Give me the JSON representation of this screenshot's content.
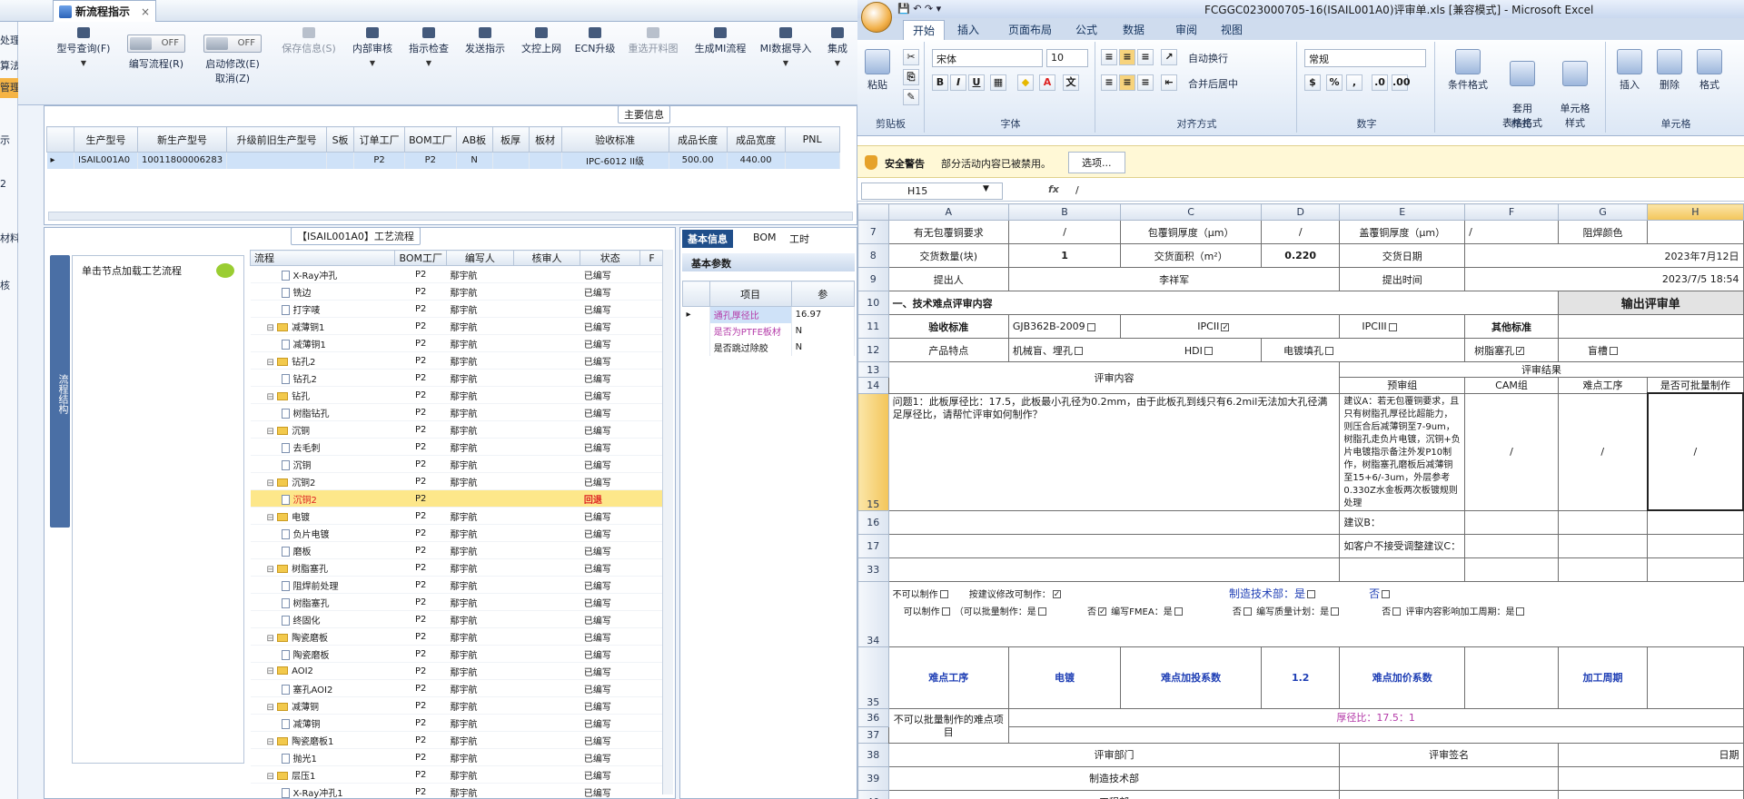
{
  "left_app": {
    "tab": {
      "label": "新流程指示",
      "close": "×"
    },
    "nav_items": [
      "处理",
      "算法",
      "管理",
      "示",
      "2",
      "材料",
      "核"
    ],
    "ribbon": [
      {
        "label": "型号查询(F)",
        "enabled": true
      },
      {
        "label": "编写流程(R)",
        "toggle": "OFF"
      },
      {
        "label": "启动修改(E)",
        "sub": "取消(Z)",
        "toggle": "OFF"
      },
      {
        "label": "保存信息(S)",
        "enabled": false
      },
      {
        "label": "内部审核",
        "enabled": true
      },
      {
        "label": "指示检查",
        "enabled": true
      },
      {
        "label": "发送指示",
        "enabled": true
      },
      {
        "label": "文控上网",
        "enabled": true
      },
      {
        "label": "ECN升级",
        "enabled": true
      },
      {
        "label": "重选开料图",
        "enabled": false
      },
      {
        "label": "生成MI流程",
        "enabled": true
      },
      {
        "label": "MI数据导入",
        "enabled": true
      },
      {
        "label": "集成",
        "enabled": true
      }
    ],
    "main_info": {
      "title": "主要信息",
      "headers": [
        "生产型号",
        "新生产型号",
        "升级前旧生产型号",
        "S板",
        "订单工厂",
        "BOM工厂",
        "AB板",
        "板厚",
        "板材",
        "验收标准",
        "成品长度",
        "成品宽度",
        "PNL"
      ],
      "row": [
        "ISAIL001A0",
        "10011800006283",
        "",
        "",
        "P2",
        "P2",
        "N",
        "",
        "",
        "IPC-6012 II级",
        "500.00",
        "440.00",
        ""
      ]
    },
    "flow": {
      "title": "【ISAIL001A0】工艺流程",
      "vtab": "流程结构",
      "hint": "单击节点加载工艺流程",
      "headers": [
        "流程",
        "BOM工厂",
        "编写人",
        "核审人",
        "状态",
        "F"
      ],
      "rows": [
        {
          "level": 1,
          "type": "doc",
          "name": "X-Ray冲孔",
          "bom": "P2",
          "writer": "鄢宇航",
          "status": "已编写"
        },
        {
          "level": 1,
          "type": "doc",
          "name": "铣边",
          "bom": "P2",
          "writer": "鄢宇航",
          "status": "已编写"
        },
        {
          "level": 1,
          "type": "doc",
          "name": "打字唛",
          "bom": "P2",
          "writer": "鄢宇航",
          "status": "已编写"
        },
        {
          "level": 0,
          "type": "folder",
          "name": "减薄铜1",
          "bom": "P2",
          "writer": "鄢宇航",
          "status": "已编写"
        },
        {
          "level": 1,
          "type": "doc",
          "name": "减薄铜1",
          "bom": "P2",
          "writer": "鄢宇航",
          "status": "已编写"
        },
        {
          "level": 0,
          "type": "folder",
          "name": "钻孔2",
          "bom": "P2",
          "writer": "鄢宇航",
          "status": "已编写"
        },
        {
          "level": 1,
          "type": "doc",
          "name": "钻孔2",
          "bom": "P2",
          "writer": "鄢宇航",
          "status": "已编写"
        },
        {
          "level": 0,
          "type": "folder",
          "name": "钻孔",
          "bom": "P2",
          "writer": "鄢宇航",
          "status": "已编写"
        },
        {
          "level": 1,
          "type": "doc",
          "name": "树脂钻孔",
          "bom": "P2",
          "writer": "鄢宇航",
          "status": "已编写"
        },
        {
          "level": 0,
          "type": "folder",
          "name": "沉铜",
          "bom": "P2",
          "writer": "鄢宇航",
          "status": "已编写"
        },
        {
          "level": 1,
          "type": "doc",
          "name": "去毛刺",
          "bom": "P2",
          "writer": "鄢宇航",
          "status": "已编写"
        },
        {
          "level": 1,
          "type": "doc",
          "name": "沉铜",
          "bom": "P2",
          "writer": "鄢宇航",
          "status": "已编写"
        },
        {
          "level": 0,
          "type": "folder",
          "name": "沉铜2",
          "bom": "P2",
          "writer": "鄢宇航",
          "status": "已编写"
        },
        {
          "level": 1,
          "type": "doc",
          "name": "沉铜2",
          "bom": "P2",
          "writer": "",
          "status": "回退",
          "highlight": true
        },
        {
          "level": 0,
          "type": "folder",
          "name": "电镀",
          "bom": "P2",
          "writer": "鄢宇航",
          "status": "已编写"
        },
        {
          "level": 1,
          "type": "doc",
          "name": "负片电镀",
          "bom": "P2",
          "writer": "鄢宇航",
          "status": "已编写"
        },
        {
          "level": 1,
          "type": "doc",
          "name": "磨板",
          "bom": "P2",
          "writer": "鄢宇航",
          "status": "已编写"
        },
        {
          "level": 0,
          "type": "folder",
          "name": "树脂塞孔",
          "bom": "P2",
          "writer": "鄢宇航",
          "status": "已编写"
        },
        {
          "level": 1,
          "type": "doc",
          "name": "阻焊前处理",
          "bom": "P2",
          "writer": "鄢宇航",
          "status": "已编写"
        },
        {
          "level": 1,
          "type": "doc",
          "name": "树脂塞孔",
          "bom": "P2",
          "writer": "鄢宇航",
          "status": "已编写"
        },
        {
          "level": 1,
          "type": "doc",
          "name": "终固化",
          "bom": "P2",
          "writer": "鄢宇航",
          "status": "已编写"
        },
        {
          "level": 0,
          "type": "folder",
          "name": "陶瓷磨板",
          "bom": "P2",
          "writer": "鄢宇航",
          "status": "已编写"
        },
        {
          "level": 1,
          "type": "doc",
          "name": "陶瓷磨板",
          "bom": "P2",
          "writer": "鄢宇航",
          "status": "已编写"
        },
        {
          "level": 0,
          "type": "folder",
          "name": "AOI2",
          "bom": "P2",
          "writer": "鄢宇航",
          "status": "已编写"
        },
        {
          "level": 1,
          "type": "doc",
          "name": "塞孔AOI2",
          "bom": "P2",
          "writer": "鄢宇航",
          "status": "已编写"
        },
        {
          "level": 0,
          "type": "folder",
          "name": "减薄铜",
          "bom": "P2",
          "writer": "鄢宇航",
          "status": "已编写"
        },
        {
          "level": 1,
          "type": "doc",
          "name": "减薄铜",
          "bom": "P2",
          "writer": "鄢宇航",
          "status": "已编写"
        },
        {
          "level": 0,
          "type": "folder",
          "name": "陶瓷磨板1",
          "bom": "P2",
          "writer": "鄢宇航",
          "status": "已编写"
        },
        {
          "level": 1,
          "type": "doc",
          "name": "抛光1",
          "bom": "P2",
          "writer": "鄢宇航",
          "status": "已编写"
        },
        {
          "level": 0,
          "type": "folder",
          "name": "层压1",
          "bom": "P2",
          "writer": "鄢宇航",
          "status": "已编写"
        },
        {
          "level": 1,
          "type": "doc",
          "name": "X-Ray冲孔1",
          "bom": "P2",
          "writer": "鄢宇航",
          "status": "已编写"
        }
      ]
    },
    "params": {
      "tabs": [
        "基本信息",
        "BOM",
        "工时"
      ],
      "subtab": "基本参数",
      "col_header": "项目",
      "col_value": "参",
      "rows": [
        {
          "item": "通孔厚径比",
          "value": "16.97",
          "selected": true
        },
        {
          "item": "是否为PTFE板材",
          "value": "N"
        },
        {
          "item": "是否跳过除胶",
          "value": "N"
        }
      ]
    }
  },
  "excel": {
    "title": "FCGGC023000705-16(ISAIL001A0)评审单.xls  [兼容模式] - Microsoft Excel",
    "tabs": [
      "开始",
      "插入",
      "页面布局",
      "公式",
      "数据",
      "审阅",
      "视图"
    ],
    "ribbon": {
      "clipboard": {
        "label": "剪贴板",
        "paste": "粘贴"
      },
      "font": {
        "label": "字体",
        "name": "宋体",
        "size": "10"
      },
      "align": {
        "label": "对齐方式",
        "wrap": "自动换行",
        "merge": "合并后居中"
      },
      "number": {
        "label": "数字",
        "format": "常规"
      },
      "styles": {
        "label": "样式",
        "cond": "条件格式",
        "table": "套用\n表格格式",
        "cell": "单元格\n样式"
      },
      "cells": {
        "label": "单元格",
        "insert": "插入",
        "delete": "删除",
        "format": "格式"
      }
    },
    "security": {
      "label": "安全警告",
      "msg": "部分活动内容已被禁用。",
      "btn": "选项..."
    },
    "namebox": "H15",
    "formula": "/",
    "columns": [
      "A",
      "B",
      "C",
      "D",
      "E",
      "F",
      "G",
      "H"
    ],
    "sheet": {
      "r7": {
        "a": "有无包覆铜要求",
        "b": "/",
        "c": "包覆铜厚度（μm）",
        "d": "/",
        "e": "盖覆铜厚度（μm）",
        "f": "/",
        "g": "阻焊颜色"
      },
      "r8": {
        "a": "交货数量(块)",
        "b": "1",
        "c": "交货面积（m²）",
        "d": "0.220",
        "e": "交货日期",
        "h": "2023年7月12日"
      },
      "r9": {
        "a": "提出人",
        "c": "李祥军",
        "e": "提出时间",
        "h": "2023/7/5 18:54"
      },
      "r10": {
        "a": "一、技术难点评审内容",
        "btn": "输出评审单"
      },
      "r11": {
        "a": "验收标准",
        "b": "GJB362B-2009",
        "c": "IPCII",
        "e": "IPCIII",
        "f": "其他标准"
      },
      "r12": {
        "a": "产品特点",
        "b": "机械盲、埋孔",
        "c": "HDI",
        "e": "电镀填孔",
        "f": "树脂塞孔",
        "g": "盲槽"
      },
      "r13": {
        "a": "评审内容",
        "result": "评审结果",
        "pre": "预审组",
        "cam": "CAM组",
        "hard": "难点工序",
        "batch": "是否可批量制作"
      },
      "r15": {
        "a": "问题1：此板厚径比：17.5，此板最小孔径为0.2mm，由于此板孔到线只有6.2mil无法加大孔径满足厚径比，请帮忙评审如何制作？",
        "e": "建议A：若无包覆铜要求，且只有树脂孔厚径比超能力，则压合后减薄铜至7-9um，树脂孔走负片电镀，沉铜+负片电镀指示备注外发P10制作，树脂塞孔磨板后减薄铜至15+6/-3um，外层参考0.330Z水金板两次板镀规则处理",
        "f": "/",
        "g": "/",
        "h": "/"
      },
      "r16": {
        "e": "建议B："
      },
      "r17": {
        "e": "如客户不接受调整建议C："
      },
      "r34": {
        "l1a": "不可以制作",
        "l1b": "按建议修改可制作：",
        "l1c": "制造技术部：是",
        "l1d": "否",
        "l2a": "可以制作",
        "l2b": "（可以批量制作：是",
        "l2c": "否",
        "l2d": "编写FMEA：是",
        "l2e": "否",
        "l2f": "编写质量计划：是",
        "l2g": "否",
        "l2h": "评审内容影响加工周期：是"
      },
      "r35": {
        "a": "难点工序",
        "b": "电镀",
        "c": "难点加投系数",
        "d": "1.2",
        "e": "难点加价系数",
        "g": "加工周期"
      },
      "r36": {
        "a": "不可以批量制作的难点项目",
        "val": "厚径比：17.5：1"
      },
      "r38": {
        "a": "评审部门",
        "e": "评审签名",
        "h": "日期"
      },
      "r39": {
        "a": "制造技术部"
      },
      "r40": {
        "a": "工程部"
      }
    }
  }
}
